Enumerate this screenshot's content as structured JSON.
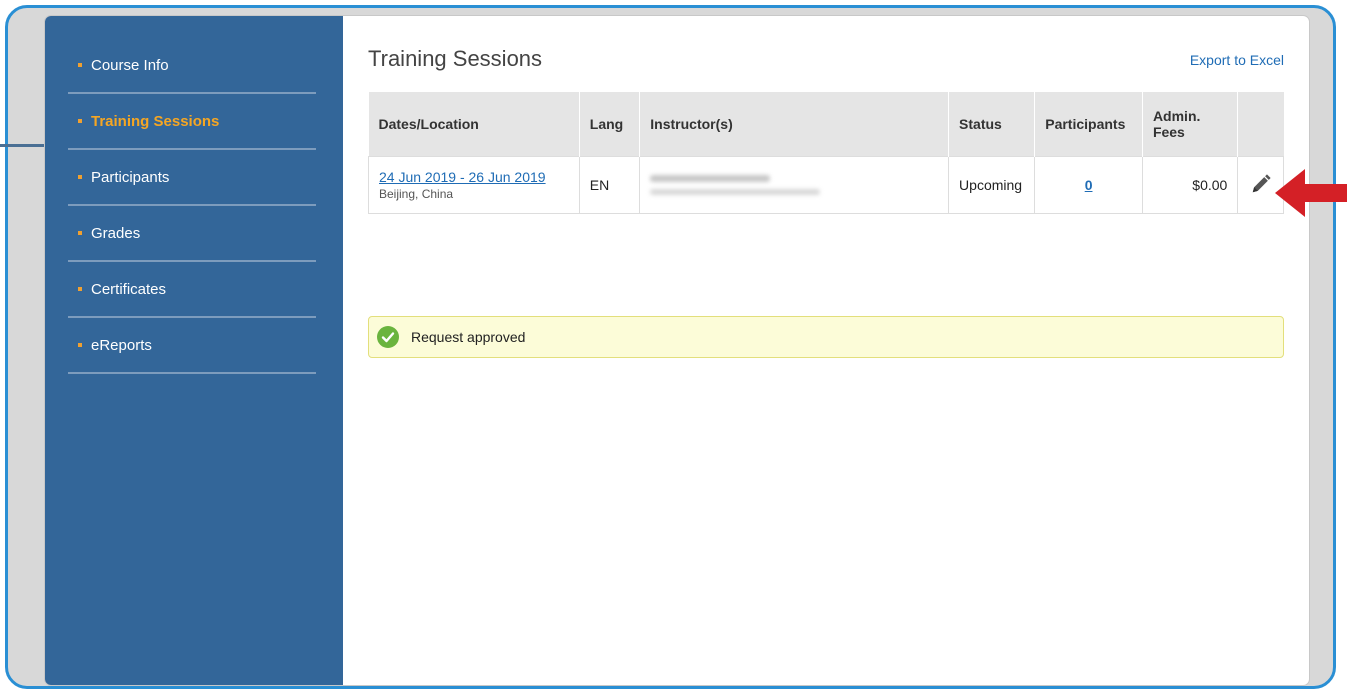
{
  "sidebar": {
    "items": [
      {
        "label": "Course Info",
        "active": false
      },
      {
        "label": "Training Sessions",
        "active": true
      },
      {
        "label": "Participants",
        "active": false
      },
      {
        "label": "Grades",
        "active": false
      },
      {
        "label": "Certificates",
        "active": false
      },
      {
        "label": "eReports",
        "active": false
      }
    ]
  },
  "main": {
    "title": "Training Sessions",
    "export_label": "Export to Excel",
    "table": {
      "headers": {
        "dates_location": "Dates/Location",
        "lang": "Lang",
        "instructors": "Instructor(s)",
        "status": "Status",
        "participants": "Participants",
        "admin_fees": "Admin. Fees"
      },
      "rows": [
        {
          "dates": "24 Jun 2019 - 26 Jun 2019",
          "location": "Beijing, China",
          "lang": "EN",
          "status": "Upcoming",
          "participants": "0",
          "admin_fees": "$0.00",
          "action_icon": "pencil-icon"
        }
      ]
    },
    "alert": {
      "message": "Request approved",
      "icon": "check-circle-icon"
    }
  },
  "colors": {
    "sidebar_bg": "#336699",
    "active_nav": "#f5a623",
    "link": "#1f6cb5",
    "frame_border": "#2a8fd4",
    "alert_bg": "#fcfcd8",
    "success_icon": "#6ab43e",
    "annotation_arrow": "#d42026"
  }
}
